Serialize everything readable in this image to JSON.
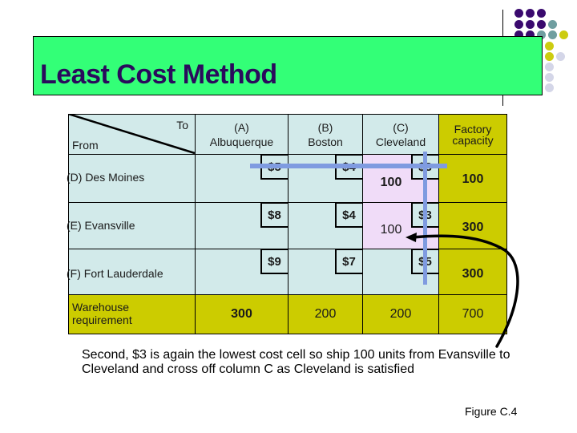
{
  "slide": {
    "title": "Least Cost Method",
    "caption": "Second, $3 is again the lowest cost cell so ship 100 units from Evansville to Cleveland and cross off column C as Cleveland is satisfied",
    "figure_label": "Figure C.4"
  },
  "colors": {
    "title_bar": "#33ff77",
    "title_text": "#2a0b5c",
    "cell_default": "#d2eaea",
    "cell_crossed_column": "#f0dcf8",
    "totals": "#cccc00",
    "cross_off_line": "#7f9be0",
    "dot_purple": "#3a0a6e",
    "dot_teal": "#6f9ea0",
    "dot_yellow": "#cccc10",
    "dot_lavender": "#d4d6e8"
  },
  "table": {
    "corner": {
      "to": "To",
      "from": "From"
    },
    "columns": [
      {
        "code": "(A)",
        "name": "Albuquerque"
      },
      {
        "code": "(B)",
        "name": "Boston"
      },
      {
        "code": "(C)",
        "name": "Cleveland"
      }
    ],
    "capacity_header": {
      "line1": "Factory",
      "line2": "capacity"
    },
    "rows": [
      {
        "label": "(D) Des Moines",
        "costs": [
          "$5",
          "$4",
          "$3"
        ],
        "allocations": [
          "",
          "",
          "100"
        ],
        "capacity": "100"
      },
      {
        "label": "(E) Evansville",
        "costs": [
          "$8",
          "$4",
          "$3"
        ],
        "allocations": [
          "",
          "",
          "100"
        ],
        "capacity": "300"
      },
      {
        "label": "(F) Fort Lauderdale",
        "costs": [
          "$9",
          "$7",
          "$5"
        ],
        "allocations": [
          "",
          "",
          ""
        ],
        "capacity": "300"
      }
    ],
    "requirement_row": {
      "label_line1": "Warehouse",
      "label_line2": "requirement",
      "values": [
        "300",
        "200",
        "200"
      ],
      "total": "700"
    }
  }
}
